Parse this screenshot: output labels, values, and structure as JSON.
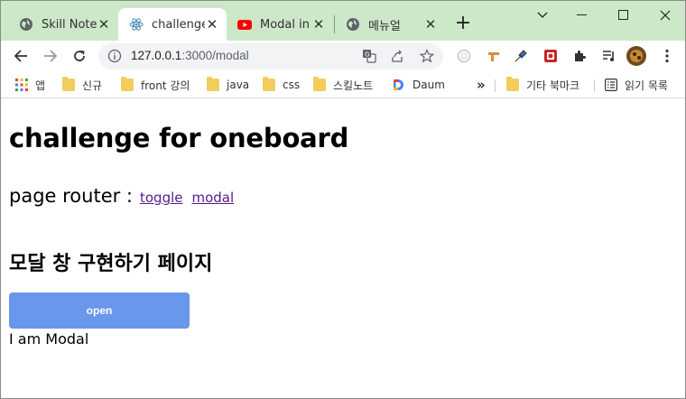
{
  "window": {
    "tabs": [
      {
        "title": "Skill Note",
        "favicon": "globe-icon",
        "active": false
      },
      {
        "title": "challenge",
        "favicon": "react-icon",
        "active": true
      },
      {
        "title": "Modal in",
        "favicon": "youtube-icon",
        "active": false
      },
      {
        "title": "메뉴얼",
        "favicon": "globe-icon",
        "active": false
      }
    ],
    "new_tab": "+",
    "controls": [
      "chevron-down-icon",
      "minimize-icon",
      "maximize-icon",
      "close-icon"
    ]
  },
  "toolbar": {
    "url_host": "127.0.0.1",
    "url_path": ":3000/modal",
    "omnibox_icons": [
      "translate-icon",
      "share-icon",
      "star-icon"
    ],
    "extensions": [
      "extension-circle-icon",
      "extension-orange-icon",
      "eyedropper-icon",
      "extension-red-icon",
      "puzzle-icon",
      "media-queue-icon",
      "profile-avatar-icon",
      "more-vert-icon"
    ]
  },
  "bookmarks": {
    "items": [
      {
        "label": "앱",
        "icon": "apps-grid-icon"
      },
      {
        "label": "신규",
        "icon": "folder-icon"
      },
      {
        "label": "front 강의",
        "icon": "folder-icon"
      },
      {
        "label": "java",
        "icon": "folder-icon"
      },
      {
        "label": "css",
        "icon": "folder-icon"
      },
      {
        "label": "스킬노트",
        "icon": "folder-icon"
      },
      {
        "label": "Daum",
        "icon": "daum-icon"
      }
    ],
    "overflow": "»",
    "other": {
      "label": "기타 북마크",
      "icon": "folder-icon"
    },
    "reading_list": {
      "label": "읽기 목록",
      "icon": "reading-list-icon"
    }
  },
  "page": {
    "title": "challenge for oneboard",
    "router_label": "page router :",
    "links": [
      "toggle",
      "modal"
    ],
    "section_heading": "모달 창 구현하기 페이지",
    "open_button": "open",
    "modal_text": "I am Modal"
  },
  "colors": {
    "tabstrip": "#cde8c9",
    "open_button": "#6897eb",
    "visited_link": "#551a8b"
  }
}
